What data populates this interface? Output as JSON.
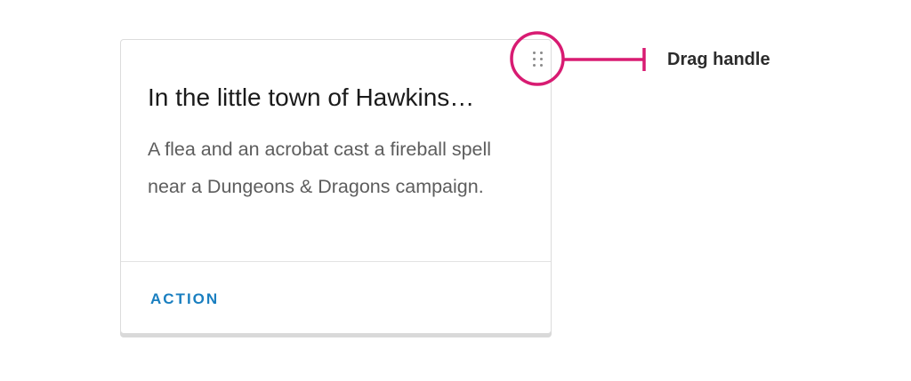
{
  "card": {
    "title": "In the little town of Hawkins…",
    "body": "A flea and an acrobat cast a fireball spell near a Dungeons & Dragons campaign.",
    "action_label": "ACTION"
  },
  "annotation": {
    "label": "Drag handle",
    "color": "#d81b72"
  },
  "colors": {
    "action": "#1a7fc0",
    "title": "#1a1a1a",
    "body": "#5d5d5d"
  },
  "icons": {
    "drag_handle": "drag-dots-icon"
  }
}
